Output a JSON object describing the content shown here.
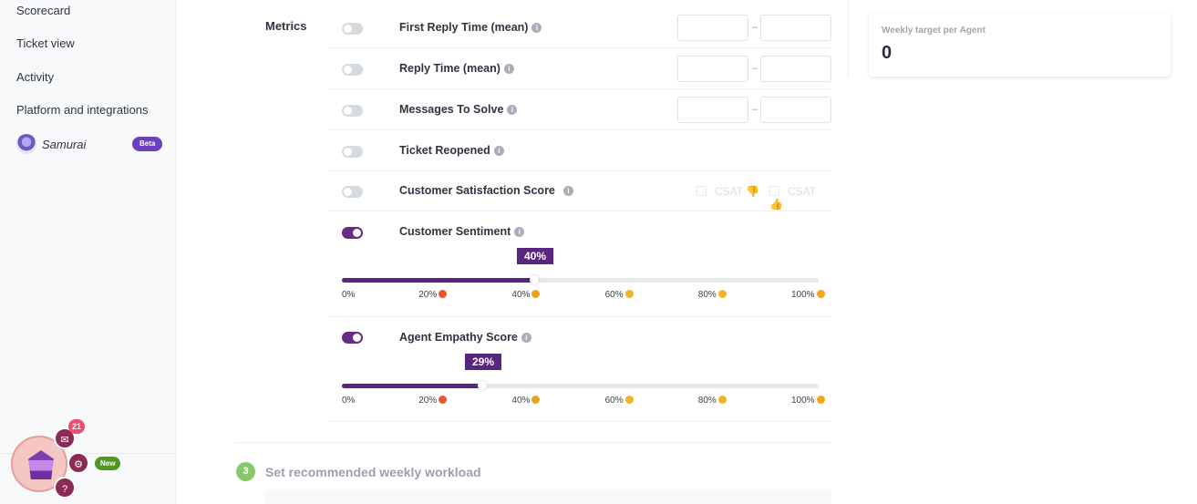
{
  "sidebar": {
    "items": [
      {
        "label": "Scorecard"
      },
      {
        "label": "Ticket view"
      },
      {
        "label": "Activity"
      },
      {
        "label": "Platform and integrations"
      }
    ],
    "samurai": {
      "label": "Samurai",
      "badge": "Beta"
    }
  },
  "launcher": {
    "notification_count": "21",
    "new_badge": "New",
    "icons": [
      "mail-icon",
      "gear-icon",
      "help-icon"
    ]
  },
  "metrics": {
    "title": "Metrics",
    "range_separator": "–",
    "rows": [
      {
        "label": "First Reply Time (mean)",
        "enabled": false,
        "range": [
          "",
          ""
        ]
      },
      {
        "label": "Reply Time (mean)",
        "enabled": false,
        "range": [
          "",
          ""
        ]
      },
      {
        "label": "Messages To Solve",
        "enabled": false,
        "range": [
          "",
          ""
        ]
      },
      {
        "label": "Ticket Reopened",
        "enabled": false
      },
      {
        "label": "Customer Satisfaction Score",
        "enabled": false,
        "options": [
          "CSAT 👎",
          "CSAT 👍"
        ]
      },
      {
        "label": "Customer Sentiment",
        "enabled": true,
        "value_label": "40%",
        "value": 40
      },
      {
        "label": "Agent Empathy Score",
        "enabled": true,
        "value_label": "29%",
        "value": 29
      }
    ],
    "scale_ticks": [
      "0%",
      "20%",
      "40%",
      "60%",
      "80%",
      "100%"
    ],
    "scale_emojis": [
      "angry-emoji",
      "frown-emoji",
      "neutral-emoji",
      "smile-emoji",
      "party-emoji"
    ]
  },
  "step": {
    "number": "3",
    "title": "Set recommended weekly workload"
  },
  "target": {
    "label": "Weekly target per Agent",
    "value": "0"
  },
  "colors": {
    "accent": "#5a2580",
    "toggle_on": "#652b86",
    "step_green": "#88c76a"
  }
}
